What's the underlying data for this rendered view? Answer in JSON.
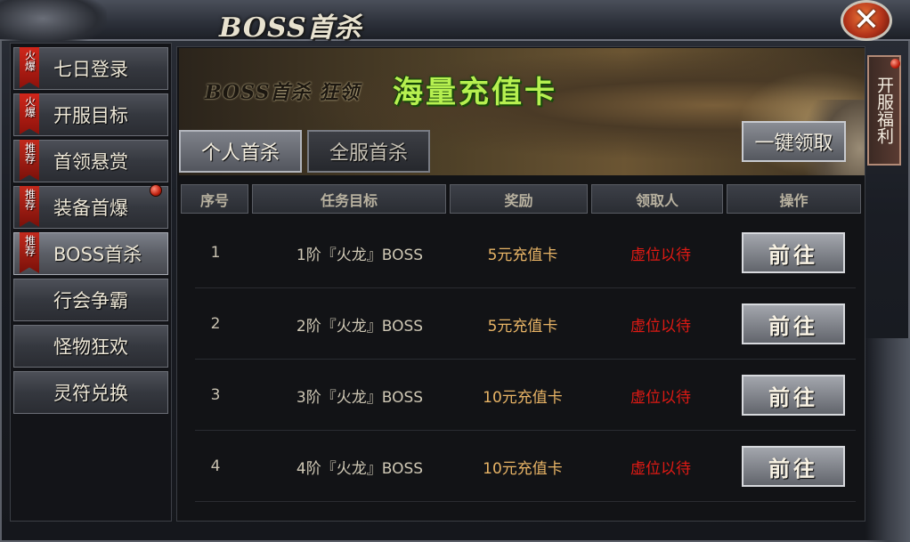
{
  "window": {
    "title": "BOSS首杀",
    "close_label": "✕"
  },
  "sidebar": {
    "items": [
      {
        "label": "七日登录",
        "badge": "火爆",
        "badge_type": "hot"
      },
      {
        "label": "开服目标",
        "badge": "火爆",
        "badge_type": "hot"
      },
      {
        "label": "首领悬赏",
        "badge": "推荐",
        "badge_type": "rec"
      },
      {
        "label": "装备首爆",
        "badge": "推荐",
        "badge_type": "rec"
      },
      {
        "label": "BOSS首杀",
        "badge": "推荐",
        "badge_type": "rec",
        "active": true
      },
      {
        "label": "行会争霸",
        "badge": ""
      },
      {
        "label": "怪物狂欢",
        "badge": ""
      },
      {
        "label": "灵符兑换",
        "badge": ""
      }
    ]
  },
  "banner": {
    "text_left": "BOSS首杀 狂领",
    "text_highlight": "海量充值卡"
  },
  "tabs": [
    {
      "label": "个人首杀",
      "active": true
    },
    {
      "label": "全服首杀",
      "active": false
    }
  ],
  "claim_all_label": "一键领取",
  "right_tab_label": "开服福利",
  "table": {
    "headers": [
      "序号",
      "任务目标",
      "奖励",
      "领取人",
      "操作"
    ],
    "rows": [
      {
        "index": "1",
        "target": "1阶『火龙』BOSS",
        "reward": "5元充值卡",
        "claimer": "虚位以待",
        "action": "前往"
      },
      {
        "index": "2",
        "target": "2阶『火龙』BOSS",
        "reward": "5元充值卡",
        "claimer": "虚位以待",
        "action": "前往"
      },
      {
        "index": "3",
        "target": "3阶『火龙』BOSS",
        "reward": "10元充值卡",
        "claimer": "虚位以待",
        "action": "前往"
      },
      {
        "index": "4",
        "target": "4阶『火龙』BOSS",
        "reward": "10元充值卡",
        "claimer": "虚位以待",
        "action": "前往"
      }
    ]
  },
  "colors": {
    "reward": "#e8b466",
    "claimer": "#e01a14",
    "banner_highlight": "#b6f050"
  }
}
